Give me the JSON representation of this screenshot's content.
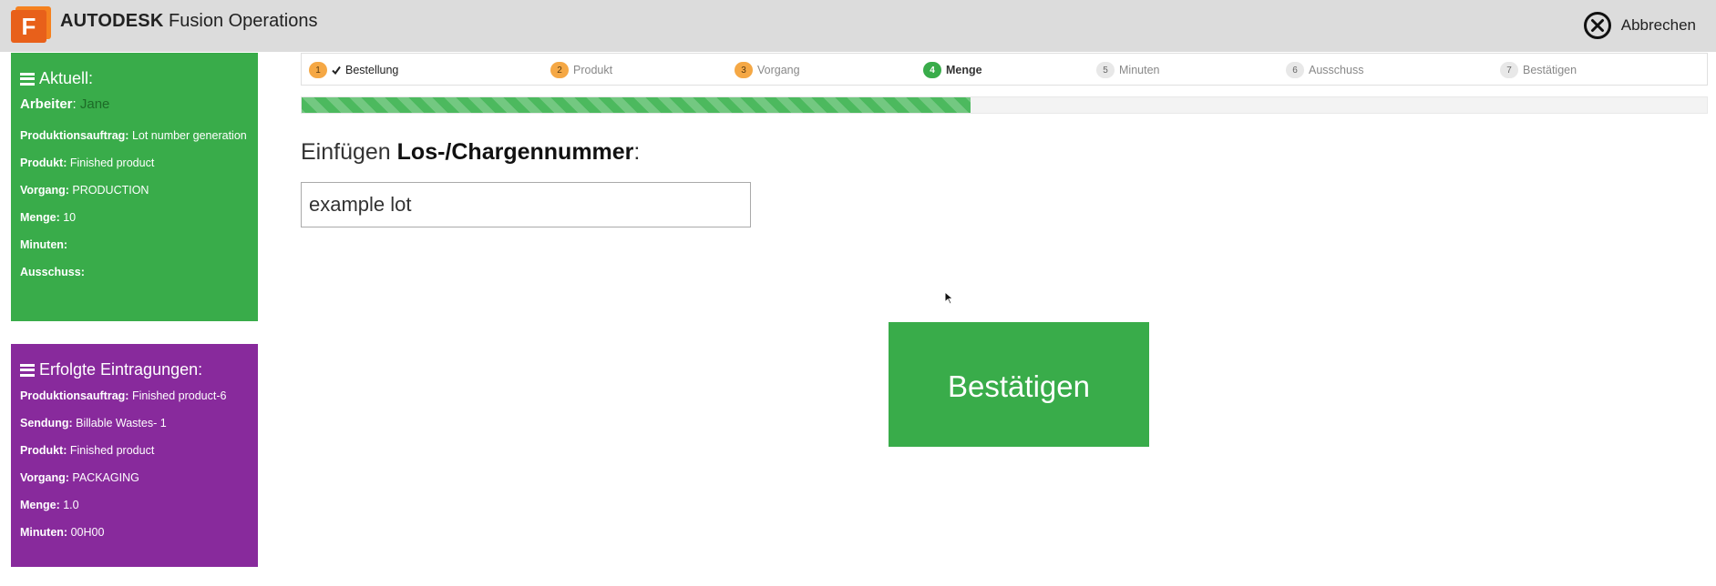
{
  "header": {
    "brand_bold": "AUTODESK",
    "brand_rest": "Fusion Operations",
    "logo_letter": "F",
    "cancel_label": "Abbrechen"
  },
  "current": {
    "title": "Aktuell:",
    "worker_label": "Arbeiter",
    "worker_value": "Jane",
    "rows": [
      {
        "label": "Produktionsauftrag:",
        "value": "Lot number generation"
      },
      {
        "label": "Produkt:",
        "value": "Finished product"
      },
      {
        "label": "Vorgang:",
        "value": "PRODUCTION"
      },
      {
        "label": "Menge:",
        "value": "10"
      },
      {
        "label": "Minuten:",
        "value": ""
      },
      {
        "label": "Ausschuss:",
        "value": ""
      }
    ]
  },
  "entries": {
    "title": "Erfolgte Eintragungen:",
    "rows": [
      {
        "label": "Produktionsauftrag:",
        "value": "Finished product-6"
      },
      {
        "label": "Sendung:",
        "value": "Billable Wastes- 1"
      },
      {
        "label": "Produkt:",
        "value": "Finished product"
      },
      {
        "label": "Vorgang:",
        "value": "PACKAGING"
      },
      {
        "label": "Menge:",
        "value": "1.0"
      },
      {
        "label": "Minuten:",
        "value": "00H00"
      }
    ]
  },
  "steps": [
    {
      "num": "1",
      "label": "Bestellung",
      "state": "done"
    },
    {
      "num": "2",
      "label": "Produkt",
      "state": "done"
    },
    {
      "num": "3",
      "label": "Vorgang",
      "state": "done"
    },
    {
      "num": "4",
      "label": "Menge",
      "state": "active"
    },
    {
      "num": "5",
      "label": "Minuten",
      "state": "todo"
    },
    {
      "num": "6",
      "label": "Ausschuss",
      "state": "todo"
    },
    {
      "num": "7",
      "label": "Bestätigen",
      "state": "todo"
    }
  ],
  "progress": {
    "fraction": 0.476
  },
  "main": {
    "prompt_prefix": "Einfügen",
    "prompt_bold": "Los-/Chargennummer",
    "prompt_suffix": ":",
    "lot_value": "example lot",
    "confirm_label": "Bestätigen"
  },
  "colors": {
    "header_bg": "#dcdcdc",
    "current_panel": "#39ac4a",
    "entries_panel": "#882a9c",
    "done_step": "#f5a845",
    "active_step": "#39ac4a",
    "confirm_button": "#39ac4a"
  },
  "icons": {
    "logo": "fusion-f-logo",
    "cancel": "circle-x-icon",
    "panel": "hamburger-icon",
    "check": "check-icon",
    "pointer": "mouse-pointer-icon"
  }
}
